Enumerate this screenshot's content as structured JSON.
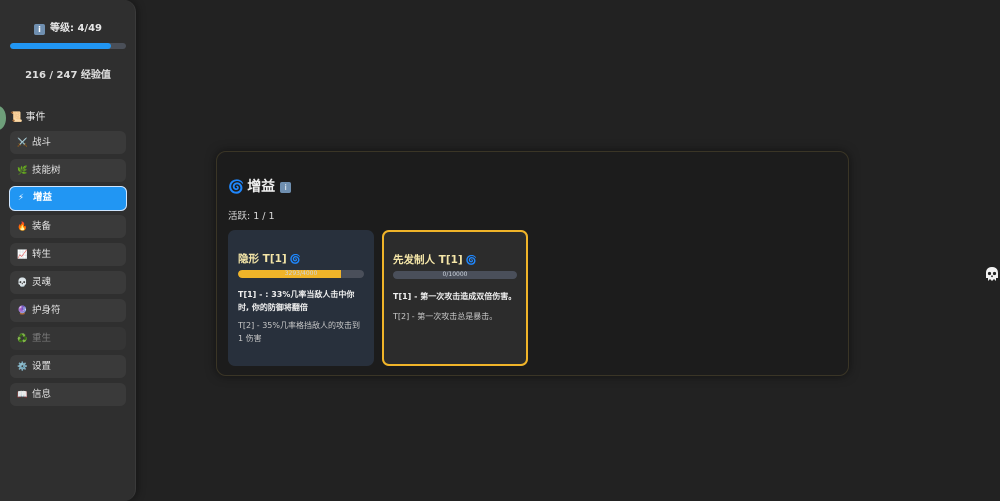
{
  "sidebar": {
    "level_badge": "ℹ️",
    "level_text": "等级: 4/49",
    "xp_progress": 0.87,
    "xp_text": "216 / 247 经验值",
    "section": {
      "icon": "📜",
      "label": "事件"
    },
    "items": [
      {
        "icon": "⚔️",
        "label": "战斗"
      },
      {
        "icon": "🌿",
        "label": "技能树"
      },
      {
        "icon": "⚡",
        "label": "增益"
      },
      {
        "icon": "🔥",
        "label": "装备"
      },
      {
        "icon": "📈",
        "label": "转生"
      },
      {
        "icon": "💀",
        "label": "灵魂"
      },
      {
        "icon": "🔮",
        "label": "护身符"
      },
      {
        "icon": "♻️",
        "label": "重生"
      },
      {
        "icon": "⚙️",
        "label": "设置"
      },
      {
        "icon": "📖",
        "label": "信息"
      }
    ],
    "active_item": "增益",
    "disabled_item": "重生"
  },
  "panel": {
    "title_icon": "🌀",
    "title": "增益",
    "info_badge": "ℹ️",
    "active_count": "活跃: 1 / 1",
    "cards": [
      {
        "title": "隐形 T[1]",
        "icon": "🌀",
        "progress_text": "3293/4000",
        "progress": 0.82,
        "t1": "T[1] - : 33%几率当敌人击中你时, 你的防御将翻倍",
        "t2": "T[2] - 35%几率格挡敌人的攻击到1 伤害"
      },
      {
        "title": "先发制人 T[1]",
        "icon": "🌀",
        "progress_text": "0/10000",
        "progress": 0.0,
        "t1": "T[1] - 第一次攻击造成双倍伤害。",
        "t2": "T[2] - 第一次攻击总是暴击。"
      }
    ]
  },
  "right_icon": "skull-ghost-icon",
  "colors": {
    "accent": "#2196f3",
    "gold": "#f0b429"
  }
}
